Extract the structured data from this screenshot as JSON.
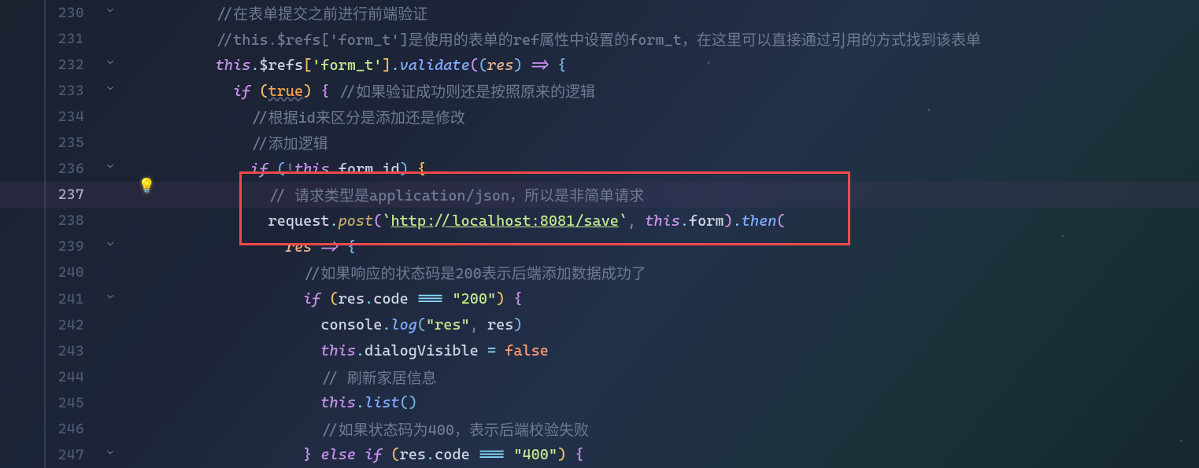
{
  "editor": {
    "active_line": 237,
    "lines": [
      {
        "num": 230,
        "fold": "v",
        "indent": 3,
        "tokens": [
          [
            "//在表单提交之前进行前端验证",
            "c-comment"
          ]
        ]
      },
      {
        "num": 231,
        "fold": "",
        "indent": 3,
        "tokens": [
          [
            "//this.$refs['form_t']是使用的表单的ref属性中设置的form_t，在这里可以直接通过引用的方式找到该表单",
            "c-comment"
          ]
        ]
      },
      {
        "num": 232,
        "fold": "v",
        "indent": 3,
        "tokens": [
          [
            "this",
            "c-kw"
          ],
          [
            ".",
            "c-dot"
          ],
          [
            "$refs",
            "c-prop"
          ],
          [
            "[",
            "c-brace"
          ],
          [
            "'form_t'",
            "c-str"
          ],
          [
            "]",
            "c-brace"
          ],
          [
            ".",
            "c-dot"
          ],
          [
            "validate",
            "c-func"
          ],
          [
            "(",
            "c-brace2"
          ],
          [
            "(",
            "c-brace3"
          ],
          [
            "res",
            "c-param"
          ],
          [
            ")",
            "c-brace3"
          ],
          [
            " ",
            ""
          ],
          [
            "=>",
            "c-arrow"
          ],
          [
            " ",
            ""
          ],
          [
            "{",
            "c-brace3"
          ]
        ]
      },
      {
        "num": 233,
        "fold": "v",
        "indent": 4,
        "tokens": [
          [
            "if",
            "c-kw"
          ],
          [
            " ",
            ""
          ],
          [
            "(",
            "c-brace"
          ],
          [
            "true",
            "c-bool"
          ],
          [
            ")",
            "c-brace"
          ],
          [
            " ",
            ""
          ],
          [
            "{",
            "c-brace2"
          ],
          [
            " ",
            ""
          ],
          [
            "//如果验证成功则还是按照原来的逻辑",
            "c-comment"
          ]
        ]
      },
      {
        "num": 234,
        "fold": "",
        "indent": 5,
        "tokens": [
          [
            "//根据id来区分是添加还是修改",
            "c-comment"
          ]
        ]
      },
      {
        "num": 235,
        "fold": "",
        "indent": 5,
        "tokens": [
          [
            "//添加逻辑",
            "c-comment"
          ]
        ]
      },
      {
        "num": 236,
        "fold": "v",
        "indent": 5,
        "tokens": [
          [
            "if",
            "c-kw"
          ],
          [
            " ",
            ""
          ],
          [
            "(",
            "c-brace3"
          ],
          [
            "!",
            "c-punc"
          ],
          [
            "this",
            "c-kw"
          ],
          [
            ".",
            "c-dot"
          ],
          [
            "form",
            "c-prop"
          ],
          [
            ".",
            "c-dot"
          ],
          [
            "id",
            "c-prop"
          ],
          [
            ")",
            "c-brace3"
          ],
          [
            " ",
            ""
          ],
          [
            "{",
            "c-brace"
          ]
        ]
      },
      {
        "num": 237,
        "fold": "",
        "indent": 6,
        "current": true,
        "tokens": [
          [
            "// 请求类型是application/json，所以是非简单请求",
            "c-comment"
          ]
        ]
      },
      {
        "num": 238,
        "fold": "",
        "indent": 6,
        "tokens": [
          [
            "request",
            "c-prop"
          ],
          [
            ".",
            "c-dot"
          ],
          [
            "post",
            "c-method"
          ],
          [
            "(",
            "c-brace2"
          ],
          [
            "`",
            "c-str"
          ],
          [
            "http://localhost:8081/save",
            "c-str-url"
          ],
          [
            "`",
            "c-str"
          ],
          [
            ",",
            "c-punc"
          ],
          [
            " ",
            ""
          ],
          [
            "this",
            "c-kw"
          ],
          [
            ".",
            "c-dot"
          ],
          [
            "form",
            "c-prop"
          ],
          [
            ")",
            "c-brace2"
          ],
          [
            ".",
            "c-dot"
          ],
          [
            "then",
            "c-func"
          ],
          [
            "(",
            "c-brace2"
          ]
        ]
      },
      {
        "num": 239,
        "fold": "v",
        "indent": 7,
        "tokens": [
          [
            "res",
            "c-param"
          ],
          [
            " ",
            ""
          ],
          [
            "=>",
            "c-arrow"
          ],
          [
            " ",
            ""
          ],
          [
            "{",
            "c-brace3"
          ]
        ]
      },
      {
        "num": 240,
        "fold": "",
        "indent": 8,
        "tokens": [
          [
            "//如果响应的状态码是200表示后端添加数据成功了",
            "c-comment"
          ]
        ]
      },
      {
        "num": 241,
        "fold": "v",
        "indent": 8,
        "tokens": [
          [
            "if",
            "c-kw"
          ],
          [
            " ",
            ""
          ],
          [
            "(",
            "c-brace"
          ],
          [
            "res",
            "c-prop"
          ],
          [
            ".",
            "c-dot"
          ],
          [
            "code",
            "c-prop"
          ],
          [
            " ",
            ""
          ],
          [
            "===",
            "c-assign"
          ],
          [
            " ",
            ""
          ],
          [
            "\"200\"",
            "c-str"
          ],
          [
            ")",
            "c-brace"
          ],
          [
            " ",
            ""
          ],
          [
            "{",
            "c-brace2"
          ]
        ]
      },
      {
        "num": 242,
        "fold": "",
        "indent": 9,
        "tokens": [
          [
            "console",
            "c-prop"
          ],
          [
            ".",
            "c-dot"
          ],
          [
            "log",
            "c-func"
          ],
          [
            "(",
            "c-brace3"
          ],
          [
            "\"res\"",
            "c-str"
          ],
          [
            ",",
            "c-punc"
          ],
          [
            " ",
            ""
          ],
          [
            "res",
            "c-prop"
          ],
          [
            ")",
            "c-brace3"
          ]
        ]
      },
      {
        "num": 243,
        "fold": "",
        "indent": 9,
        "tokens": [
          [
            "this",
            "c-kw"
          ],
          [
            ".",
            "c-dot"
          ],
          [
            "dialogVisible",
            "c-prop"
          ],
          [
            " ",
            ""
          ],
          [
            "=",
            "c-assign"
          ],
          [
            " ",
            ""
          ],
          [
            "false",
            "c-false"
          ]
        ]
      },
      {
        "num": 244,
        "fold": "",
        "indent": 9,
        "tokens": [
          [
            "// 刷新家居信息",
            "c-comment"
          ]
        ]
      },
      {
        "num": 245,
        "fold": "",
        "indent": 9,
        "tokens": [
          [
            "this",
            "c-kw"
          ],
          [
            ".",
            "c-dot"
          ],
          [
            "list",
            "c-func"
          ],
          [
            "()",
            "c-brace3"
          ]
        ]
      },
      {
        "num": 246,
        "fold": "",
        "indent": 9,
        "tokens": [
          [
            "//如果状态码为400，表示后端校验失败",
            "c-comment"
          ]
        ]
      },
      {
        "num": 247,
        "fold": "v",
        "indent": 8,
        "tokens": [
          [
            "}",
            "c-brace2"
          ],
          [
            " ",
            ""
          ],
          [
            "else",
            "c-kw"
          ],
          [
            " ",
            ""
          ],
          [
            "if",
            "c-kw"
          ],
          [
            " ",
            ""
          ],
          [
            "(",
            "c-brace"
          ],
          [
            "res",
            "c-prop"
          ],
          [
            ".",
            "c-dot"
          ],
          [
            "code",
            "c-prop"
          ],
          [
            " ",
            ""
          ],
          [
            "===",
            "c-assign"
          ],
          [
            " ",
            ""
          ],
          [
            "\"400\"",
            "c-str"
          ],
          [
            ")",
            "c-brace"
          ],
          [
            " ",
            ""
          ],
          [
            "{",
            "c-brace2"
          ]
        ]
      }
    ]
  },
  "icons": {
    "bulb": "💡",
    "chevron": "⌄"
  }
}
